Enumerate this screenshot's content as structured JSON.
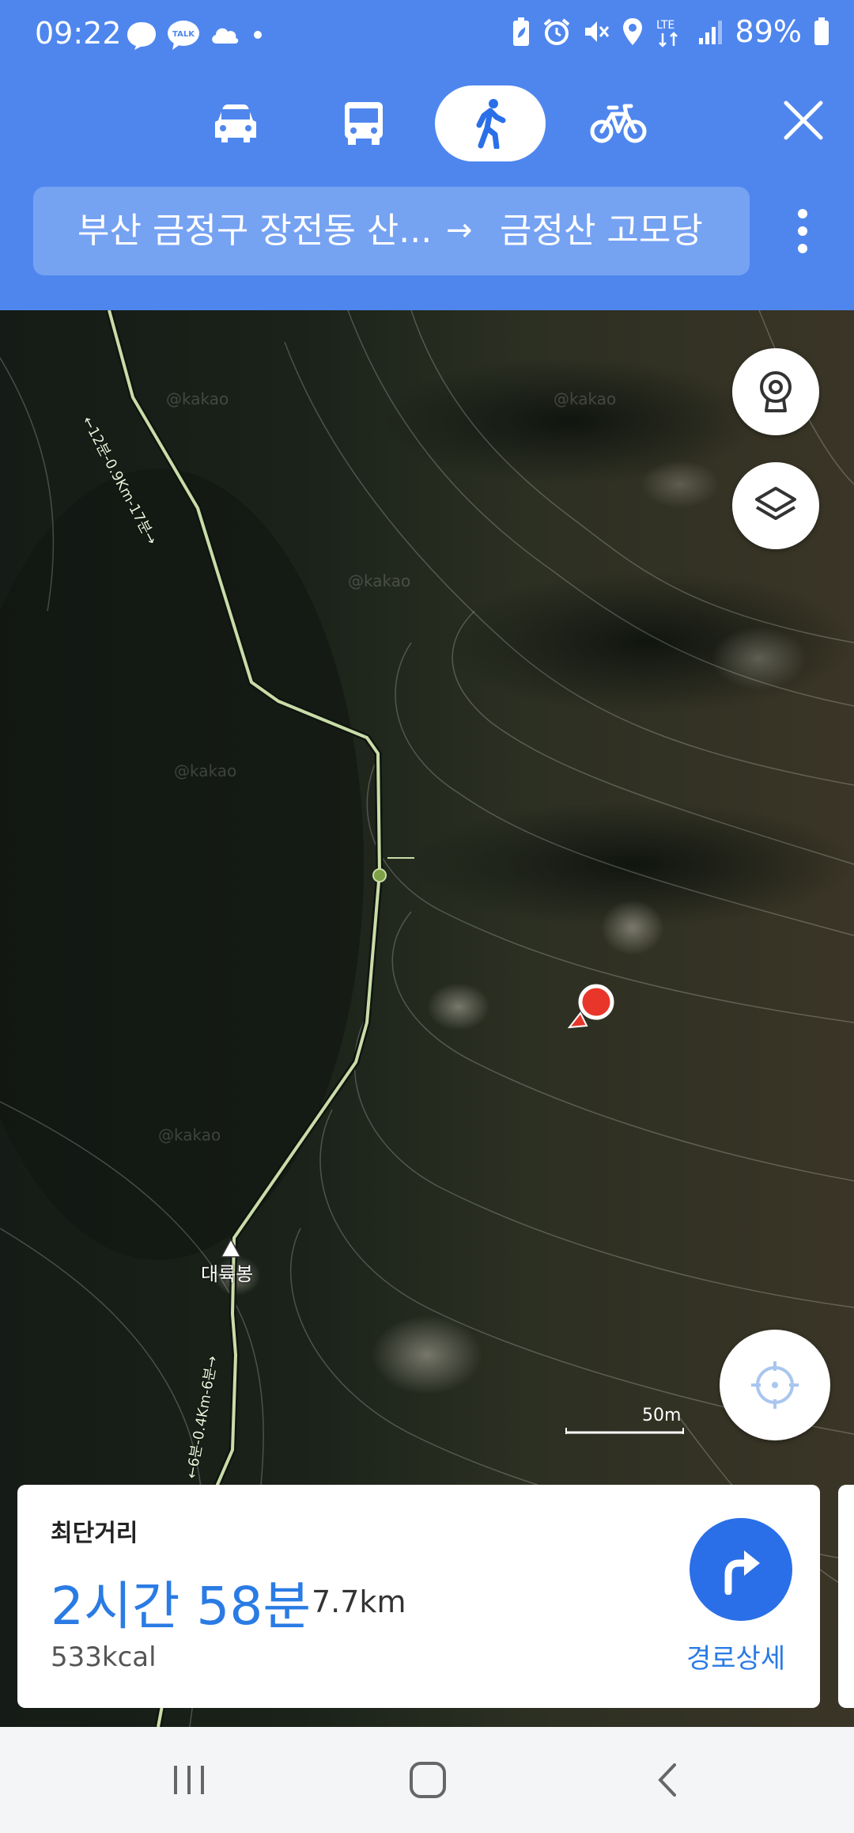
{
  "status": {
    "time": "09:22",
    "battery": "89%",
    "network": "LTE",
    "left_icons": [
      "messenger-icon",
      "kakaotalk-icon",
      "cloud-icon",
      "dot-icon"
    ],
    "right_icons": [
      "battery-saver-icon",
      "alarm-icon",
      "mute-icon",
      "location-icon",
      "lte-icon",
      "signal-icon",
      "battery-icon"
    ]
  },
  "modes": [
    {
      "name": "car",
      "icon": "car-icon",
      "active": false
    },
    {
      "name": "bus",
      "icon": "bus-icon",
      "active": false
    },
    {
      "name": "walk",
      "icon": "walk-icon",
      "active": true
    },
    {
      "name": "bike",
      "icon": "bike-icon",
      "active": false
    }
  ],
  "route": {
    "from": "부산 금정구 장전동 산...",
    "arrow": "→",
    "to": "금정산 고모당"
  },
  "map": {
    "route_labels": [
      "←12분-0.9Km-17분→",
      "←6분-0.4Km-6분→"
    ],
    "peak_label": "대륙봉",
    "scale": "50m",
    "watermark": "@kakao"
  },
  "card": {
    "type": "최단거리",
    "duration": "2시간 58분",
    "distance": "7.7km",
    "calories": "533kcal",
    "detail_label": "경로상세"
  },
  "colors": {
    "header": "#4f86ee",
    "route_box": "#76a2f2",
    "accent": "#2a7be4",
    "route_line": "#c9dca8",
    "marker": "#e8362a"
  }
}
